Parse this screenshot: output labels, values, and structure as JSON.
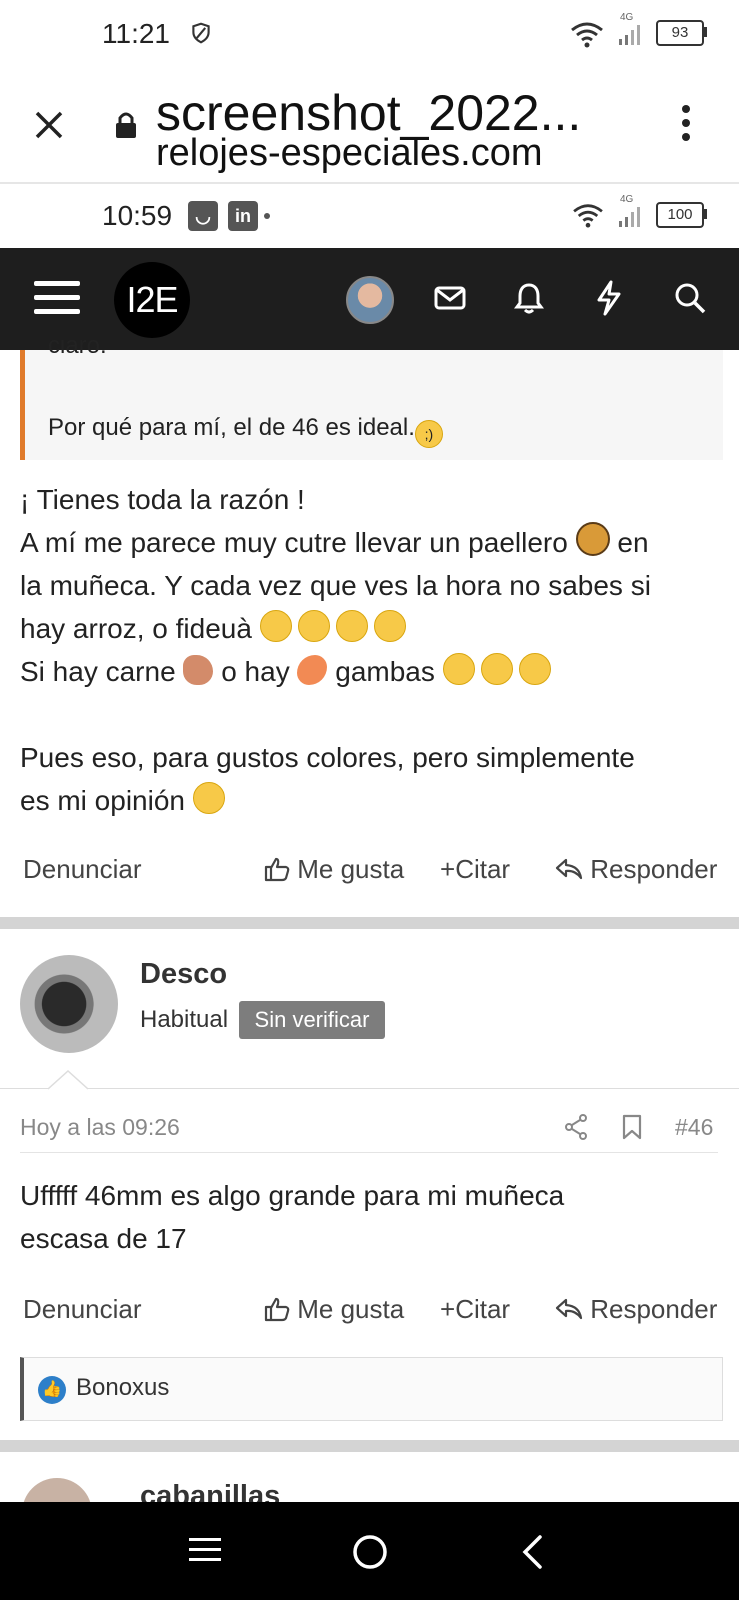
{
  "status": {
    "time": "11:21",
    "network": "4G",
    "battery": "93"
  },
  "chrome": {
    "title": "screenshot_2022...",
    "url": "relojes-especiales.com"
  },
  "inner_status": {
    "time": "10:59",
    "network": "4G",
    "battery": "100"
  },
  "forum": {
    "logo": "I2E"
  },
  "post1": {
    "quote_cut": "claro.",
    "quote_line": "Por qué para mí, el de 46 es ideal.",
    "line1": "¡ Tienes toda la razón !",
    "line2a": "A mí me parece muy cutre llevar un paellero",
    "line2b": "en",
    "line3": "la muñeca. Y cada vez que ves la hora no sabes si",
    "line4": "hay arroz, o fideuà",
    "line5a": "Si hay carne",
    "line5b": "o hay",
    "line5c": "gambas",
    "line6": "Pues eso, para gustos colores, pero simplemente",
    "line7": "es mi opinión"
  },
  "actions": {
    "report": "Denunciar",
    "like": "Me gusta",
    "quote": "Citar",
    "reply": "Responder"
  },
  "post2": {
    "username": "Desco",
    "user_title": "Habitual",
    "badge": "Sin verificar",
    "time": "Hoy a las 09:26",
    "number": "#46",
    "line1": "Ufffff 46mm es algo grande para mi muñeca",
    "line2": "escasa de 17",
    "reaction_user": "Bonoxus"
  },
  "post3": {
    "username": "cabanillas"
  }
}
